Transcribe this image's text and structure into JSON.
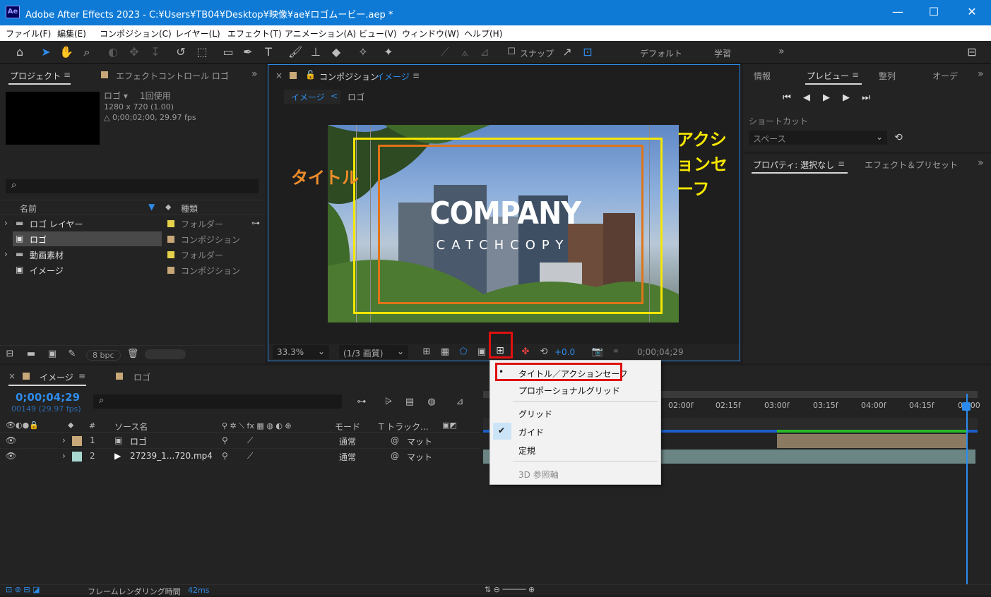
{
  "titlebar": {
    "app_icon": "Ae",
    "title": "Adobe After Effects 2023 - C:¥Users¥TB04¥Desktop¥映像¥ae¥ロゴムービー.aep *",
    "minimize": "—",
    "maximize": "☐",
    "close": "✕"
  },
  "menu": [
    "ファイル(F)",
    "編集(E)",
    "コンポジション(C)",
    "レイヤー(L)",
    "エフェクト(T)",
    "アニメーション(A)",
    "ビュー(V)",
    "ウィンドウ(W)",
    "ヘルプ(H)"
  ],
  "toolbar": {
    "snap_label": "スナップ",
    "workspace_default": "デフォルト",
    "workspace_learn": "学習",
    "more": "»"
  },
  "project": {
    "tab_project": "プロジェクト",
    "tab_effect_controls": "エフェクトコントロール ロゴ",
    "more": "»",
    "selected_name": "ロゴ ▾",
    "usage": "1回使用",
    "resolution": "1280 x 720 (1.00)",
    "duration": "△ 0;00;02;00, 29.97 fps",
    "col_name": "名前",
    "col_type": "種類",
    "items": [
      {
        "name": "ロゴ レイヤー",
        "type": "フォルダー",
        "color": "#e6d24a"
      },
      {
        "name": "ロゴ",
        "type": "コンポジション",
        "color": "#c8a878"
      },
      {
        "name": "動画素材",
        "type": "フォルダー",
        "color": "#e6d24a"
      },
      {
        "name": "イメージ",
        "type": "コンポジション",
        "color": "#c8a878"
      }
    ],
    "bpc": "8 bpc"
  },
  "composition": {
    "tab_label": "コンポジション",
    "tab_name": "イメージ",
    "crumb_current": "イメージ",
    "crumb_back": "<",
    "crumb_parent": "ロゴ",
    "company": "COMPANY",
    "catchcopy": "CATCHCOPY",
    "annotation_title": "タイトル",
    "annotation_action": "アクションセーフ",
    "zoom": "33.3%",
    "resolution": "(1/3 画質)",
    "exposure": "+0.0",
    "timecode": "0;00;04;29"
  },
  "guide_menu": {
    "items": [
      {
        "label": "タイトル／アクションセーフ",
        "mark": "•",
        "disabled": false
      },
      {
        "label": "プロポーショナルグリッド",
        "mark": "",
        "disabled": false
      },
      {
        "label": "グリッド",
        "mark": "",
        "disabled": false
      },
      {
        "label": "ガイド",
        "mark": "✔",
        "disabled": false
      },
      {
        "label": "定規",
        "mark": "",
        "disabled": false
      },
      {
        "label": "3D 参照軸",
        "mark": "",
        "disabled": true
      }
    ]
  },
  "right_panel": {
    "tab_info": "情報",
    "tab_preview": "プレビュー",
    "tab_align": "整列",
    "tab_audio": "オーデ",
    "more": "»",
    "shortcut_label": "ショートカット",
    "shortcut_value": "スペース",
    "tab_properties": "プロパティ: 選択なし",
    "tab_effects": "エフェクト＆プリセット"
  },
  "timeline": {
    "tab_name": "イメージ",
    "tab_other": "ロゴ",
    "timecode": "0;00;04;29",
    "frames": "00149 (29.97 fps)",
    "col_source": "ソース名",
    "col_mode": "モード",
    "col_track": "T  トラック...",
    "layers": [
      {
        "num": "1",
        "name": "ロゴ",
        "mode": "通常",
        "track": "マット",
        "color": "#c8a878"
      },
      {
        "num": "2",
        "name": "27239_1...720.mp4",
        "mode": "通常",
        "track": "マット",
        "color": "#a8d8d0"
      }
    ],
    "ruler": [
      "02:00f",
      "02:15f",
      "03:00f",
      "03:15f",
      "04:00f",
      "04:15f",
      "05:00"
    ],
    "footer": "フレームレンダリング時間",
    "render_time": "42ms"
  }
}
